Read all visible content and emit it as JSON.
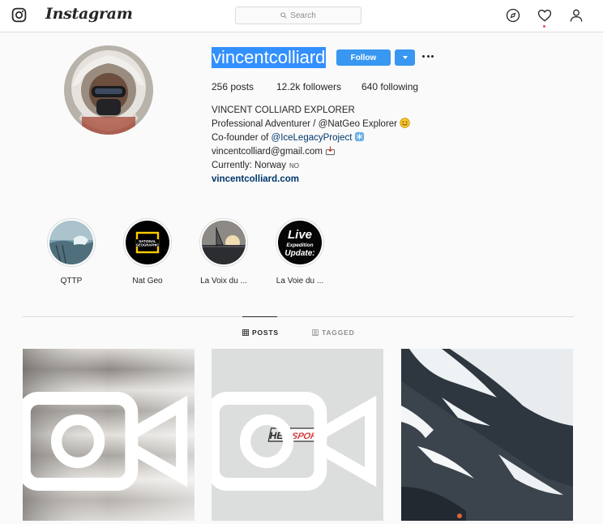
{
  "nav": {
    "logo": "Instagram",
    "search_placeholder": "Search"
  },
  "profile": {
    "username": "vincentcolliard",
    "follow_label": "Follow",
    "stats": [
      {
        "value": "256",
        "label": "posts"
      },
      {
        "value": "12.2k",
        "label": "followers"
      },
      {
        "value": "640",
        "label": "following"
      }
    ],
    "full_name": "VINCENT COLLIARD EXPLORER",
    "bio_line1": "Professional Adventurer / @NatGeo Explorer",
    "bio_line2_prefix": "Co-founder of ",
    "bio_line2_link": "@IceLegacyProject",
    "bio_line3": "vincentcolliard@gmail.com",
    "bio_line4": "Currently: Norway",
    "bio_line4_tag": "NO",
    "website": "vincentcolliard.com"
  },
  "highlights": [
    {
      "label": "QTTP"
    },
    {
      "label": "Nat Geo",
      "art_text_1": "NATIONAL",
      "art_text_2": "GEOGRAPHIC"
    },
    {
      "label": "La Voix du ..."
    },
    {
      "label": "La Voie du ...",
      "art_text_1": "Live",
      "art_text_2": "Expedition",
      "art_text_3": "Update:"
    }
  ],
  "tabs": [
    {
      "label": "POSTS",
      "active": true
    },
    {
      "label": "TAGGED",
      "active": false
    }
  ],
  "posts": [
    {
      "kind": "video"
    },
    {
      "kind": "video",
      "logo_text_1": "HEL",
      "logo_text_2": "SPORT"
    },
    {
      "kind": "image"
    }
  ],
  "colors": {
    "follow_blue": "#3897f0",
    "selection_blue": "#3390ff",
    "link": "#00376b"
  }
}
